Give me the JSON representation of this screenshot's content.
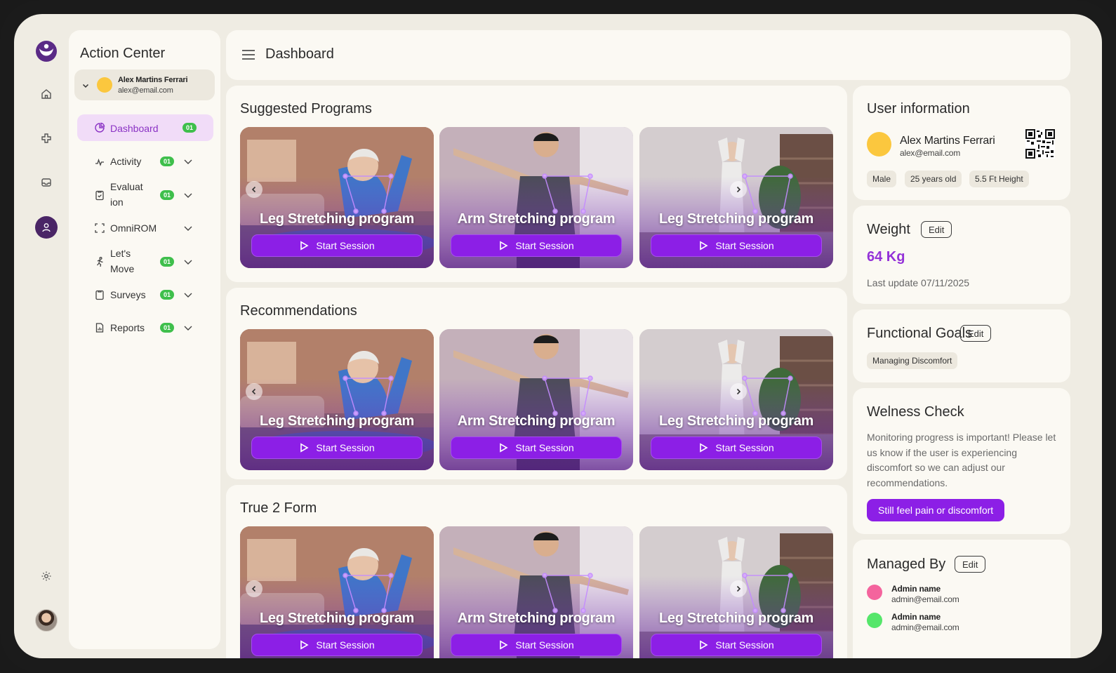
{
  "sidebar": {
    "title": "Action Center",
    "user": {
      "name": "Alex Martins Ferrari",
      "email": "alex@email.com"
    },
    "nav": {
      "dashboard": {
        "label": "Dashboard",
        "badge": "01"
      },
      "items": [
        {
          "label": "Activity",
          "badge": "01"
        },
        {
          "label": "Evaluat",
          "label2": "ion",
          "badge": "01"
        },
        {
          "label": "OmniROM"
        },
        {
          "label": "Let's",
          "label2": "Move",
          "badge": "01"
        },
        {
          "label": "Surveys",
          "badge": "01"
        },
        {
          "label": "Reports",
          "badge": "01"
        }
      ]
    }
  },
  "header": {
    "title": "Dashboard"
  },
  "sections": [
    {
      "title": "Suggested Programs",
      "cards": [
        {
          "title": "Leg Stretching program",
          "button": "Start Session"
        },
        {
          "title": "Arm Stretching program",
          "button": "Start Session"
        },
        {
          "title": "Leg Stretching program",
          "button": "Start Session"
        }
      ]
    },
    {
      "title": "Recommendations",
      "cards": [
        {
          "title": "Leg Stretching program",
          "button": "Start Session"
        },
        {
          "title": "Arm Stretching program",
          "button": "Start Session"
        },
        {
          "title": "Leg Stretching program",
          "button": "Start Session"
        }
      ]
    },
    {
      "title": "True 2 Form",
      "cards": [
        {
          "title": "Leg Stretching program",
          "button": "Start Session"
        },
        {
          "title": "Arm Stretching program",
          "button": "Start Session"
        },
        {
          "title": "Leg Stretching program",
          "button": "Start Session"
        }
      ]
    }
  ],
  "user_info": {
    "title": "User information",
    "name": "Alex Martins Ferrari",
    "email": "alex@email.com",
    "tags": [
      "Male",
      "25 years old",
      "5.5 Ft Height"
    ]
  },
  "weight": {
    "title": "Weight",
    "edit": "Edit",
    "value": "64 Kg",
    "last_update": "Last update 07/11/2025"
  },
  "goals": {
    "title": "Functional Goals",
    "edit": "Edit",
    "tags": [
      "Managing Discomfort"
    ]
  },
  "wellness": {
    "title": "Welness Check",
    "text": "Monitoring progress is important! Please let us know if the user is experiencing discomfort so we can adjust our recommendations.",
    "button": "Still feel pain or discomfort"
  },
  "managed_by": {
    "title": "Managed By",
    "edit": "Edit",
    "admins": [
      {
        "name": "Admin name",
        "email": "admin@email.com",
        "color": "#f4649d"
      },
      {
        "name": "Admin name",
        "email": "admin@email.com",
        "color": "#55e66a"
      }
    ]
  },
  "colors": {
    "accent": "#8c1fe6",
    "badge": "#3fbf4c",
    "brand": "#4a2566"
  }
}
